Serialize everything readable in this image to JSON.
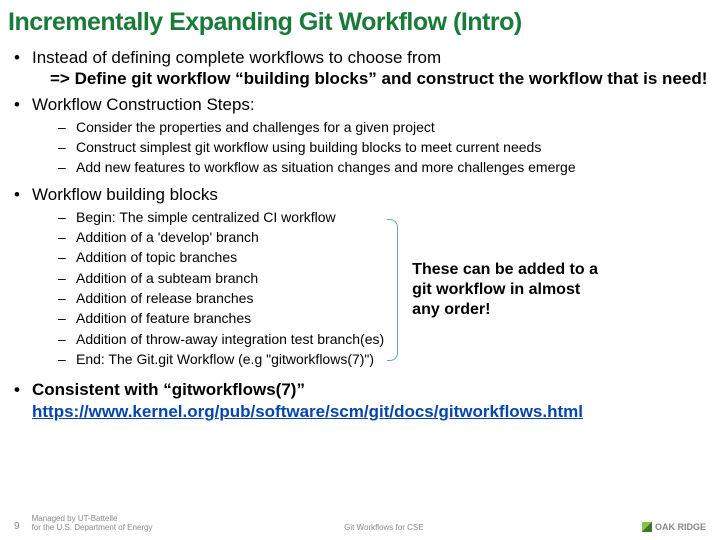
{
  "title": "Incrementally Expanding Git Workflow (Intro)",
  "b1": {
    "line1": "Instead of defining complete workflows to choose from",
    "line2": "=> Define git workflow “building blocks” and construct the workflow that is need!"
  },
  "b2": {
    "heading": "Workflow Construction Steps:",
    "items": [
      "Consider the properties and challenges for a given project",
      "Construct simplest git workflow using building blocks to meet current needs",
      "Add new features to workflow as situation changes and more challenges emerge"
    ]
  },
  "b3": {
    "heading": "Workflow building blocks",
    "items": [
      "Begin: The simple centralized CI workflow",
      "Addition of a 'develop' branch",
      "Addition of topic branches",
      "Addition of a subteam branch",
      "Addition of release branches",
      "Addition of feature branches",
      "Addition of throw-away integration test branch(es)",
      "End: The Git.git Workflow (e.g \"gitworkflows(7)\")"
    ],
    "side_note": "These can be added to a git workflow in almost any order!"
  },
  "b4": {
    "text": "Consistent with “gitworkflows(7)”",
    "url": "https://www.kernel.org/pub/software/scm/git/docs/gitworkflows.html"
  },
  "footer": {
    "page": "9",
    "left1": "Managed by UT-Battelle",
    "left2": "for the U.S. Department of Energy",
    "center": "Git Workflows for CSE",
    "logo": "OAK RIDGE"
  }
}
